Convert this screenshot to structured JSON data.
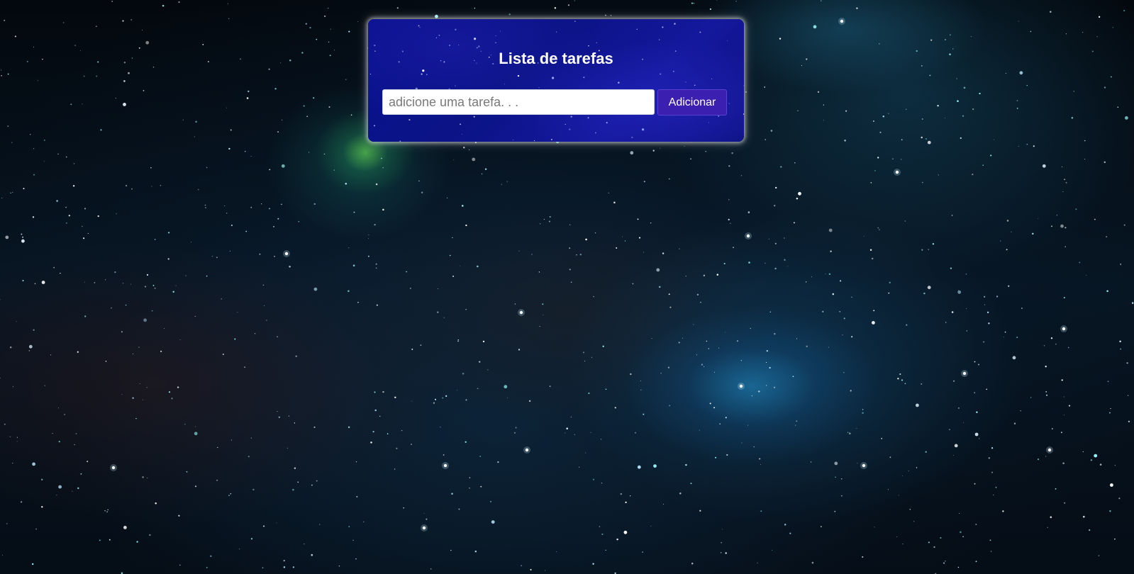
{
  "page": {
    "title": "Lista de tarefas"
  },
  "task_form": {
    "input_value": "",
    "input_placeholder": "adicione uma tarefa. . .",
    "add_button_label": "Adicionar"
  },
  "colors": {
    "card_background": "#0b1386",
    "button_background": "#3a1fb0",
    "title_text": "#ffffff"
  }
}
